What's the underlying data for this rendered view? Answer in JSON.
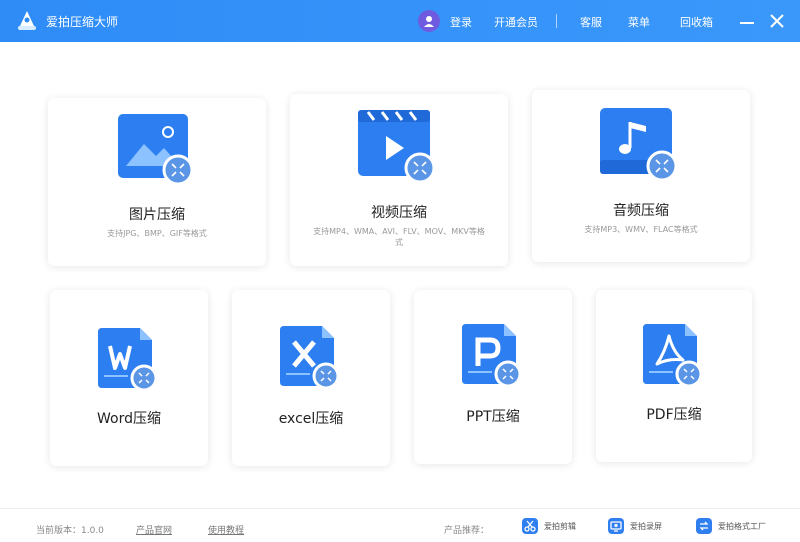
{
  "app": {
    "title": "爱拍压缩大师"
  },
  "header": {
    "login": "登录",
    "vip": "开通会员",
    "customer_service": "客服",
    "menu": "菜单",
    "recycle": "回收箱"
  },
  "colors": {
    "titlebar": "#3391f8",
    "icon_blue": "#2d7ef0",
    "icon_light": "#5aa6ff",
    "badge": "#5b96e6"
  },
  "cards": [
    {
      "title": "图片压缩",
      "sub": "支持JPG、BMP、GIF等格式",
      "icon": "image-icon"
    },
    {
      "title": "视频压缩",
      "sub": "支持MP4、WMA、AVI、FLV、MOV、MKV等格式",
      "icon": "video-icon"
    },
    {
      "title": "音频压缩",
      "sub": "支持MP3、WMV、FLAC等格式",
      "icon": "music-icon"
    },
    {
      "title": "Word压缩",
      "icon": "word-icon"
    },
    {
      "title": "excel压缩",
      "icon": "excel-icon"
    },
    {
      "title": "PPT压缩",
      "icon": "ppt-icon"
    },
    {
      "title": "PDF压缩",
      "icon": "pdf-icon"
    }
  ],
  "footer": {
    "version": "当前版本：1.0.0",
    "official_site": "产品官网",
    "tutorial": "使用教程",
    "recommend": "产品推荐：",
    "products": [
      "爱拍剪辑",
      "爱拍录屏",
      "爱拍格式工厂"
    ]
  }
}
